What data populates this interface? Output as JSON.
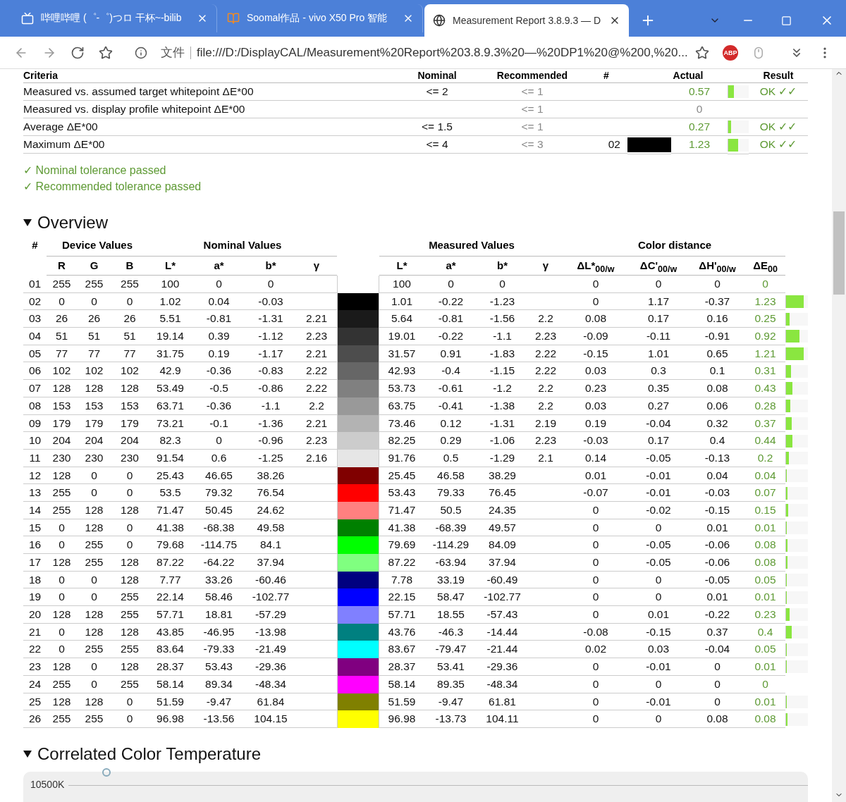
{
  "browser": {
    "tabs": [
      {
        "title": "哔哩哔哩 (゜-゜)つロ 干杯~-bilib",
        "kind": "tv",
        "selected": false
      },
      {
        "title": "Soomal作品 - vivo X50 Pro 智能",
        "kind": "book",
        "selected": false
      },
      {
        "title": "Measurement Report 3.8.9.3 — D",
        "kind": "globe",
        "selected": true
      }
    ],
    "scheme_label": "文件",
    "url": "file:///D:/DisplayCAL/Measurement%20Report%203.8.9.3%20—%20DP1%20@%200,%20...",
    "extension_badge": "ABP"
  },
  "criteria": {
    "columns": [
      "Criteria",
      "Nominal",
      "Recommended",
      "#",
      "Actual",
      "Result"
    ],
    "rows": [
      {
        "name": "Measured vs. assumed target whitepoint ΔE*00",
        "nominal": "<= 2",
        "recommended": "<= 1",
        "actual": "0.57",
        "passed": true,
        "level": 0.27,
        "result": "OK ✓✓"
      },
      {
        "name": "Measured vs. display profile whitepoint ΔE*00",
        "recommended": "<= 1",
        "actual": "0",
        "passed": false,
        "level": 0
      },
      {
        "name": "Average ΔE*00",
        "nominal": "<= 1.5",
        "recommended": "<= 1",
        "actual": "0.27",
        "passed": true,
        "level": 0.13,
        "result": "OK ✓✓"
      },
      {
        "name": "Maximum ΔE*00",
        "nominal": "<= 4",
        "recommended": "<= 3",
        "index": "02",
        "color": "#000000",
        "actual": "1.23",
        "passed": true,
        "level": 0.47,
        "result": "OK ✓✓"
      }
    ],
    "messages": [
      "✓ Nominal tolerance passed",
      "✓ Recommended tolerance passed"
    ]
  },
  "overview": {
    "title": "Overview",
    "expanded": true,
    "group_headers": [
      "#",
      "Device Values",
      "Nominal Values",
      "Measured Values",
      "Color distance"
    ],
    "columns": [
      "R",
      "G",
      "B",
      "L*",
      "a*",
      "b*",
      "γ",
      "L*",
      "a*",
      "b*",
      "γ",
      "ΔL*$_{00/w}$",
      "ΔC'$_{00/w}$",
      "ΔH'$_{00/w}$",
      "ΔE$_{00}$"
    ],
    "rows": [
      {
        "id": "01",
        "device": [
          "255",
          "255",
          "255"
        ],
        "nominal": [
          "100",
          "0",
          "0"
        ],
        "measured": [
          "100",
          "0",
          "0"
        ],
        "distance": [
          "0",
          "0",
          "0",
          "0"
        ],
        "level": 0
      },
      {
        "id": "02",
        "device": [
          "0",
          "0",
          "0"
        ],
        "nominal": [
          "1.02",
          "0.04",
          "-0.03"
        ],
        "measured": [
          "1.01",
          "-0.22",
          "-1.23"
        ],
        "distance": [
          "0",
          "1.17",
          "-0.37",
          "1.23"
        ],
        "level": 0.82
      },
      {
        "id": "03",
        "device": [
          "26",
          "26",
          "26"
        ],
        "nominal": [
          "5.51",
          "-0.81",
          "-1.31",
          "2.21"
        ],
        "measured": [
          "5.64",
          "-0.81",
          "-1.56",
          "2.2"
        ],
        "distance": [
          "0.08",
          "0.17",
          "0.16",
          "0.25"
        ],
        "level": 0.17
      },
      {
        "id": "04",
        "device": [
          "51",
          "51",
          "51"
        ],
        "nominal": [
          "19.14",
          "0.39",
          "-1.12",
          "2.23"
        ],
        "measured": [
          "19.01",
          "-0.22",
          "-1.1",
          "2.23"
        ],
        "distance": [
          "-0.09",
          "-0.11",
          "-0.91",
          "0.92"
        ],
        "level": 0.61
      },
      {
        "id": "05",
        "device": [
          "77",
          "77",
          "77"
        ],
        "nominal": [
          "31.75",
          "0.19",
          "-1.17",
          "2.21"
        ],
        "measured": [
          "31.57",
          "0.91",
          "-1.83",
          "2.22"
        ],
        "distance": [
          "-0.15",
          "1.01",
          "0.65",
          "1.21"
        ],
        "level": 0.81
      },
      {
        "id": "06",
        "device": [
          "102",
          "102",
          "102"
        ],
        "nominal": [
          "42.9",
          "-0.36",
          "-0.83",
          "2.22"
        ],
        "measured": [
          "42.93",
          "-0.4",
          "-1.15",
          "2.22"
        ],
        "distance": [
          "0.03",
          "0.3",
          "0.1",
          "0.31"
        ],
        "level": 0.21
      },
      {
        "id": "07",
        "device": [
          "128",
          "128",
          "128"
        ],
        "nominal": [
          "53.49",
          "-0.5",
          "-0.86",
          "2.22"
        ],
        "measured": [
          "53.73",
          "-0.61",
          "-1.2",
          "2.2"
        ],
        "distance": [
          "0.23",
          "0.35",
          "0.08",
          "0.43"
        ],
        "level": 0.29
      },
      {
        "id": "08",
        "device": [
          "153",
          "153",
          "153"
        ],
        "nominal": [
          "63.71",
          "-0.36",
          "-1.1",
          "2.2"
        ],
        "measured": [
          "63.75",
          "-0.41",
          "-1.38",
          "2.2"
        ],
        "distance": [
          "0.03",
          "0.27",
          "0.06",
          "0.28"
        ],
        "level": 0.19
      },
      {
        "id": "09",
        "device": [
          "179",
          "179",
          "179"
        ],
        "nominal": [
          "73.21",
          "-0.1",
          "-1.36",
          "2.21"
        ],
        "measured": [
          "73.46",
          "0.12",
          "-1.31",
          "2.19"
        ],
        "distance": [
          "0.19",
          "-0.04",
          "0.32",
          "0.37"
        ],
        "level": 0.25
      },
      {
        "id": "10",
        "device": [
          "204",
          "204",
          "204"
        ],
        "nominal": [
          "82.3",
          "0",
          "-0.96",
          "2.23"
        ],
        "measured": [
          "82.25",
          "0.29",
          "-1.06",
          "2.23"
        ],
        "distance": [
          "-0.03",
          "0.17",
          "0.4",
          "0.44"
        ],
        "level": 0.29
      },
      {
        "id": "11",
        "device": [
          "230",
          "230",
          "230"
        ],
        "nominal": [
          "91.54",
          "0.6",
          "-1.25",
          "2.16"
        ],
        "measured": [
          "91.76",
          "0.5",
          "-1.29",
          "2.1"
        ],
        "distance": [
          "0.14",
          "-0.05",
          "-0.13",
          "0.2"
        ],
        "level": 0.13
      },
      {
        "id": "12",
        "device": [
          "128",
          "0",
          "0"
        ],
        "nominal": [
          "25.43",
          "46.65",
          "38.26"
        ],
        "measured": [
          "25.45",
          "46.58",
          "38.29"
        ],
        "distance": [
          "0.01",
          "-0.01",
          "0.04",
          "0.04"
        ],
        "level": 0.03
      },
      {
        "id": "13",
        "device": [
          "255",
          "0",
          "0"
        ],
        "nominal": [
          "53.5",
          "79.32",
          "76.54"
        ],
        "measured": [
          "53.43",
          "79.33",
          "76.45"
        ],
        "distance": [
          "-0.07",
          "-0.01",
          "-0.03",
          "0.07"
        ],
        "level": 0.05
      },
      {
        "id": "14",
        "device": [
          "255",
          "128",
          "128"
        ],
        "nominal": [
          "71.47",
          "50.45",
          "24.62"
        ],
        "measured": [
          "71.47",
          "50.5",
          "24.35"
        ],
        "distance": [
          "0",
          "-0.02",
          "-0.15",
          "0.15"
        ],
        "level": 0.1
      },
      {
        "id": "15",
        "device": [
          "0",
          "128",
          "0"
        ],
        "nominal": [
          "41.38",
          "-68.38",
          "49.58"
        ],
        "measured": [
          "41.38",
          "-68.39",
          "49.57"
        ],
        "distance": [
          "0",
          "0",
          "0.01",
          "0.01"
        ],
        "level": 0.01
      },
      {
        "id": "16",
        "device": [
          "0",
          "255",
          "0"
        ],
        "nominal": [
          "79.68",
          "-114.75",
          "84.1"
        ],
        "measured": [
          "79.69",
          "-114.29",
          "84.09"
        ],
        "distance": [
          "0",
          "-0.05",
          "-0.06",
          "0.08"
        ],
        "level": 0.05
      },
      {
        "id": "17",
        "device": [
          "128",
          "255",
          "128"
        ],
        "nominal": [
          "87.22",
          "-64.22",
          "37.94"
        ],
        "measured": [
          "87.22",
          "-63.94",
          "37.94"
        ],
        "distance": [
          "0",
          "-0.05",
          "-0.06",
          "0.08"
        ],
        "level": 0.05
      },
      {
        "id": "18",
        "device": [
          "0",
          "0",
          "128"
        ],
        "nominal": [
          "7.77",
          "33.26",
          "-60.46"
        ],
        "measured": [
          "7.78",
          "33.19",
          "-60.49"
        ],
        "distance": [
          "0",
          "0",
          "-0.05",
          "0.05"
        ],
        "level": 0.03
      },
      {
        "id": "19",
        "device": [
          "0",
          "0",
          "255"
        ],
        "nominal": [
          "22.14",
          "58.46",
          "-102.77"
        ],
        "measured": [
          "22.15",
          "58.47",
          "-102.77"
        ],
        "distance": [
          "0",
          "0",
          "0.01",
          "0.01"
        ],
        "level": 0.01
      },
      {
        "id": "20",
        "device": [
          "128",
          "128",
          "255"
        ],
        "nominal": [
          "57.71",
          "18.81",
          "-57.29"
        ],
        "measured": [
          "57.71",
          "18.55",
          "-57.43"
        ],
        "distance": [
          "0",
          "0.01",
          "-0.22",
          "0.23"
        ],
        "level": 0.15
      },
      {
        "id": "21",
        "device": [
          "0",
          "128",
          "128"
        ],
        "nominal": [
          "43.85",
          "-46.95",
          "-13.98"
        ],
        "measured": [
          "43.76",
          "-46.3",
          "-14.44"
        ],
        "distance": [
          "-0.08",
          "-0.15",
          "0.37",
          "0.4"
        ],
        "level": 0.27
      },
      {
        "id": "22",
        "device": [
          "0",
          "255",
          "255"
        ],
        "nominal": [
          "83.64",
          "-79.33",
          "-21.49"
        ],
        "measured": [
          "83.67",
          "-79.47",
          "-21.44"
        ],
        "distance": [
          "0.02",
          "0.03",
          "-0.04",
          "0.05"
        ],
        "level": 0.03
      },
      {
        "id": "23",
        "device": [
          "128",
          "0",
          "128"
        ],
        "nominal": [
          "28.37",
          "53.43",
          "-29.36"
        ],
        "measured": [
          "28.37",
          "53.41",
          "-29.36"
        ],
        "distance": [
          "0",
          "-0.01",
          "0",
          "0.01"
        ],
        "level": 0.01
      },
      {
        "id": "24",
        "device": [
          "255",
          "0",
          "255"
        ],
        "nominal": [
          "58.14",
          "89.34",
          "-48.34"
        ],
        "measured": [
          "58.14",
          "89.35",
          "-48.34"
        ],
        "distance": [
          "0",
          "0",
          "0",
          "0"
        ],
        "level": 0
      },
      {
        "id": "25",
        "device": [
          "128",
          "128",
          "0"
        ],
        "nominal": [
          "51.59",
          "-9.47",
          "61.84"
        ],
        "measured": [
          "51.59",
          "-9.47",
          "61.81"
        ],
        "distance": [
          "0",
          "-0.01",
          "0",
          "0.01"
        ],
        "level": 0.01
      },
      {
        "id": "26",
        "device": [
          "255",
          "255",
          "0"
        ],
        "nominal": [
          "96.98",
          "-13.56",
          "104.15"
        ],
        "measured": [
          "96.98",
          "-13.73",
          "104.11"
        ],
        "distance": [
          "0",
          "0",
          "0.08",
          "0.08"
        ],
        "level": 0.05
      }
    ]
  },
  "cct": {
    "title": "Correlated Color Temperature",
    "expanded": true,
    "axis_label": "10500K"
  }
}
